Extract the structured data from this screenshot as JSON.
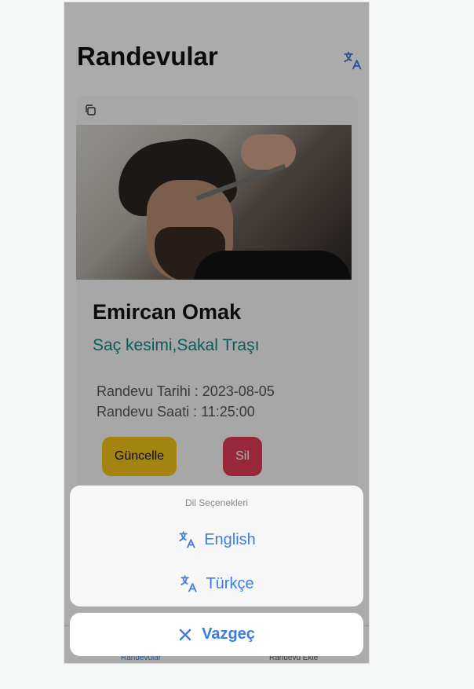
{
  "header": {
    "title": "Randevular"
  },
  "card": {
    "name": "Emircan Omak",
    "services": "Saç kesimi,Sakal Traşı",
    "date_line": "Randevu Tarihi : 2023-08-05",
    "time_line": "Randevu Saati : 11:25:00",
    "update_label": "Güncelle",
    "delete_label": "Sil"
  },
  "tabbar": {
    "appointments_label": "Randevular",
    "add_label": "Randevu Ekle"
  },
  "action_sheet": {
    "title": "Dil Seçenekleri",
    "options": [
      {
        "label": "English",
        "icon": "translate-icon"
      },
      {
        "label": "Türkçe",
        "icon": "translate-icon"
      }
    ],
    "cancel_label": "Vazgeç",
    "cancel_icon": "close-icon"
  },
  "colors": {
    "accent": "#3b7de0",
    "services": "#0f8a86",
    "update": "#f5c518",
    "delete": "#e33b55"
  }
}
